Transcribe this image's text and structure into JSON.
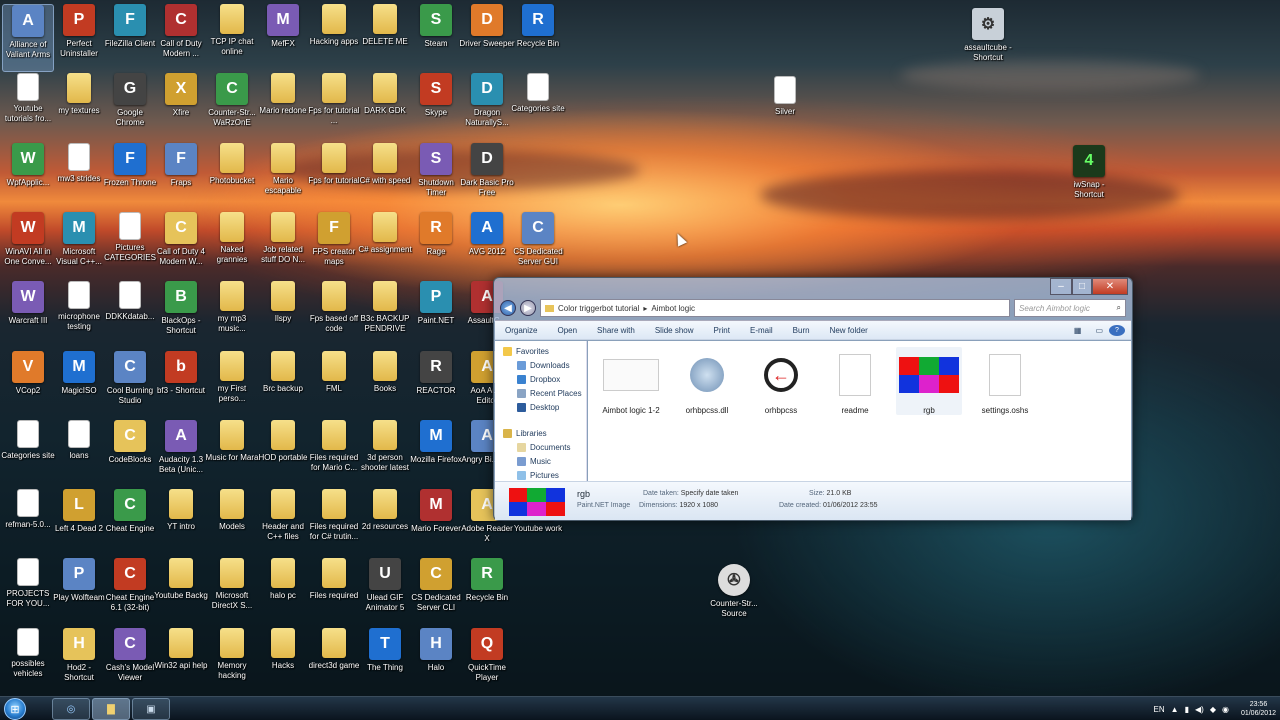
{
  "desktop": {
    "columns": [
      [
        "Alliance of Valiant Arms",
        "Youtube tutorials fro...",
        "WpfApplic...",
        "WinAVI All in One Conve...",
        "Warcraft III",
        "VCop2",
        "Categories site",
        "refman-5.0...",
        "PROJECTS FOR YOU...",
        "possibles vehicles"
      ],
      [
        "Perfect Uninstaller",
        "my textures",
        "mw3 strides",
        "Microsoft Visual C++...",
        "microphone testing",
        "MagicISO",
        "loans",
        "Left 4 Dead 2",
        "Play Wolfteam",
        "Hod2 - Shortcut"
      ],
      [
        "FileZilla Client",
        "Google Chrome",
        "Frozen Throne",
        "Pictures CATEGORIES",
        "DDKKdatab...",
        "Cool Burning Studio",
        "CodeBlocks",
        "Cheat Engine",
        "Cheat Engine 6.1 (32-bit)",
        "Cash's Model Viewer"
      ],
      [
        "Call of Duty Modern ...",
        "Xfire",
        "Fraps",
        "Call of Duty 4 Modern W...",
        "BlackOps - Shortcut",
        "bf3 - Shortcut",
        "Audacity 1.3 Beta (Unic...",
        "YT intro",
        "Youtube Backg",
        "Win32 api help"
      ],
      [
        "TCP IP chat online",
        "Counter-Str... WaRzOnE",
        "Photobucket",
        "Naked grannies",
        "my mp3 music...",
        "my First perso...",
        "Music for Mara",
        "Models",
        "Microsoft DirectX S...",
        "Memory hacking"
      ],
      [
        "MefFX",
        "Mario redone",
        "Mario escapable",
        "Job related stuff DO N...",
        "Ilspy",
        "Brc backup",
        "HOD portable",
        "Header and C++ files",
        "halo pc",
        "Hacks"
      ],
      [
        "Hacking apps",
        "Fps for tutorial ...",
        "Fps for tutorial",
        "FPS creator maps",
        "Fps based off code",
        "FML",
        "Files required for Mario C...",
        "Files required for C# trutin...",
        "Files required",
        "direct3d game"
      ],
      [
        "DELETE ME",
        "DARK GDK",
        "C# with speed",
        "C# assignment",
        "B3c BACKUP PENDRIVE",
        "Books",
        "3d person shooter latest",
        "2d resources",
        "Ulead GIF Animator 5",
        "The Thing"
      ],
      [
        "Steam",
        "Skype",
        "Shutdown Timer",
        "Rage",
        "Paint.NET",
        "REACTOR",
        "Mozilla Firefox",
        "Mario Forever",
        "CS Dedicated Server CLI",
        "Halo"
      ],
      [
        "Driver Sweeper",
        "Dragon NaturallyS...",
        "Dark Basic Pro Free",
        "AVG 2012",
        "AssaultC...",
        "AoA Au... Editor",
        "Angry Bi... Rio",
        "Adobe Reader X",
        "Recycle Bin",
        "QuickTime Player"
      ],
      [
        "Recycle Bin",
        "Categories site",
        "",
        "CS Dedicated Server GUI",
        "",
        "",
        "",
        "Youtube work",
        "",
        ""
      ]
    ],
    "extra_icons": {
      "assaultcube": "assaultcube - Shortcut",
      "silver": "Silver",
      "iwsnap": "iwSnap - Shortcut",
      "cssource": "Counter-Str... Source"
    }
  },
  "explorer": {
    "breadcrumb": [
      "Color triggerbot tutorial",
      "Aimbot logic"
    ],
    "search_placeholder": "Search Aimbot logic",
    "toolbar": [
      "Organize",
      "Open",
      "Share with",
      "Slide show",
      "Print",
      "E-mail",
      "Burn",
      "New folder"
    ],
    "nav": {
      "favorites": "Favorites",
      "fav_items": [
        "Downloads",
        "Dropbox",
        "Recent Places",
        "Desktop"
      ],
      "libraries": "Libraries",
      "lib_items": [
        "Documents",
        "Music",
        "Pictures"
      ]
    },
    "files": [
      "Aimbot logic 1-2",
      "orhbpcss.dll",
      "orhbpcss",
      "readme",
      "rgb",
      "settings.oshs"
    ],
    "details": {
      "name": "rgb",
      "type": "Paint.NET Image",
      "date_taken_label": "Date taken:",
      "date_taken": "Specify date taken",
      "dimensions_label": "Dimensions:",
      "dimensions": "1920 x 1080",
      "size_label": "Size:",
      "size": "21.0 KB",
      "created_label": "Date created:",
      "created": "01/06/2012 23:55"
    }
  },
  "taskbar": {
    "lang": "EN",
    "time": "23:56",
    "date": "01/06/2012"
  },
  "colors": {
    "accent": "#2a7fd0"
  }
}
